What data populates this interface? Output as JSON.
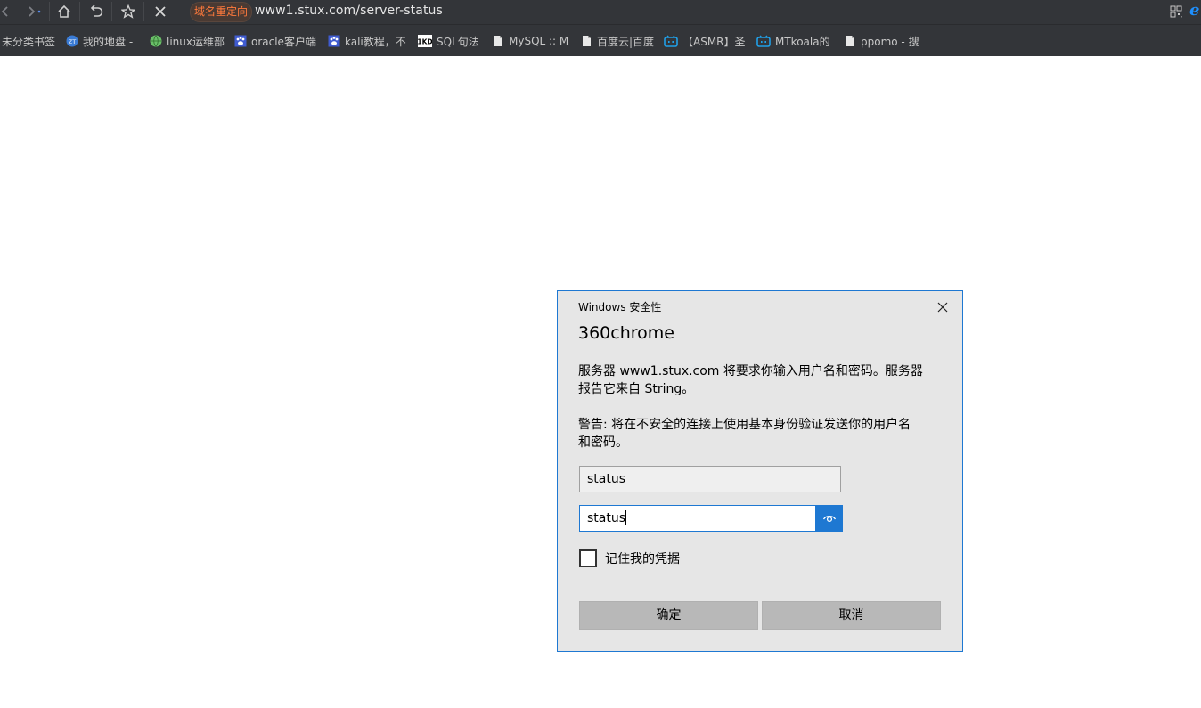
{
  "browser": {
    "redirect_badge": "域名重定向",
    "url": "www1.stux.com/server-status",
    "icons": [
      "back-icon",
      "forward-icon",
      "home-icon",
      "undo-icon",
      "star-icon",
      "close-icon",
      "qr-code-icon",
      "ie-icon"
    ]
  },
  "bookmarks": [
    {
      "label": "未分类书签",
      "icon": "none"
    },
    {
      "label": "我的地盘 -",
      "icon": "zt-icon"
    },
    {
      "label": "linux运维部",
      "icon": "globe-icon"
    },
    {
      "label": "oracle客户端",
      "icon": "paw-icon"
    },
    {
      "label": "kali教程，不",
      "icon": "paw-icon"
    },
    {
      "label": "SQL句法",
      "icon": "1kd-icon"
    },
    {
      "label": "MySQL :: M",
      "icon": "page-icon"
    },
    {
      "label": "百度云|百度",
      "icon": "page-icon"
    },
    {
      "label": "【ASMR】圣",
      "icon": "bilibili-icon"
    },
    {
      "label": "MTkoala的",
      "icon": "bilibili-icon"
    },
    {
      "label": "ppomo - 搜",
      "icon": "page-icon"
    }
  ],
  "bookmark_icon_texts": {
    "zt": "ZT",
    "kd": "1KD"
  },
  "dialog": {
    "title": "Windows 安全性",
    "app_name": "360chrome",
    "message_line1": "服务器 www1.stux.com 将要求你输入用户名和密码。服务器",
    "message_line2": "报告它来自 String。",
    "warning_line1": "警告: 将在不安全的连接上使用基本身份验证发送你的用户名",
    "warning_line2": "和密码。",
    "username_value": "status",
    "password_value": "status",
    "remember_label": "记住我的凭据",
    "remember_checked": false,
    "ok_label": "确定",
    "cancel_label": "取消"
  },
  "colors": {
    "toolbar_bg": "#333539",
    "accent_blue": "#1e78d2",
    "redirect_orange": "#ff7a3c",
    "dialog_bg": "#e6e6e6"
  }
}
